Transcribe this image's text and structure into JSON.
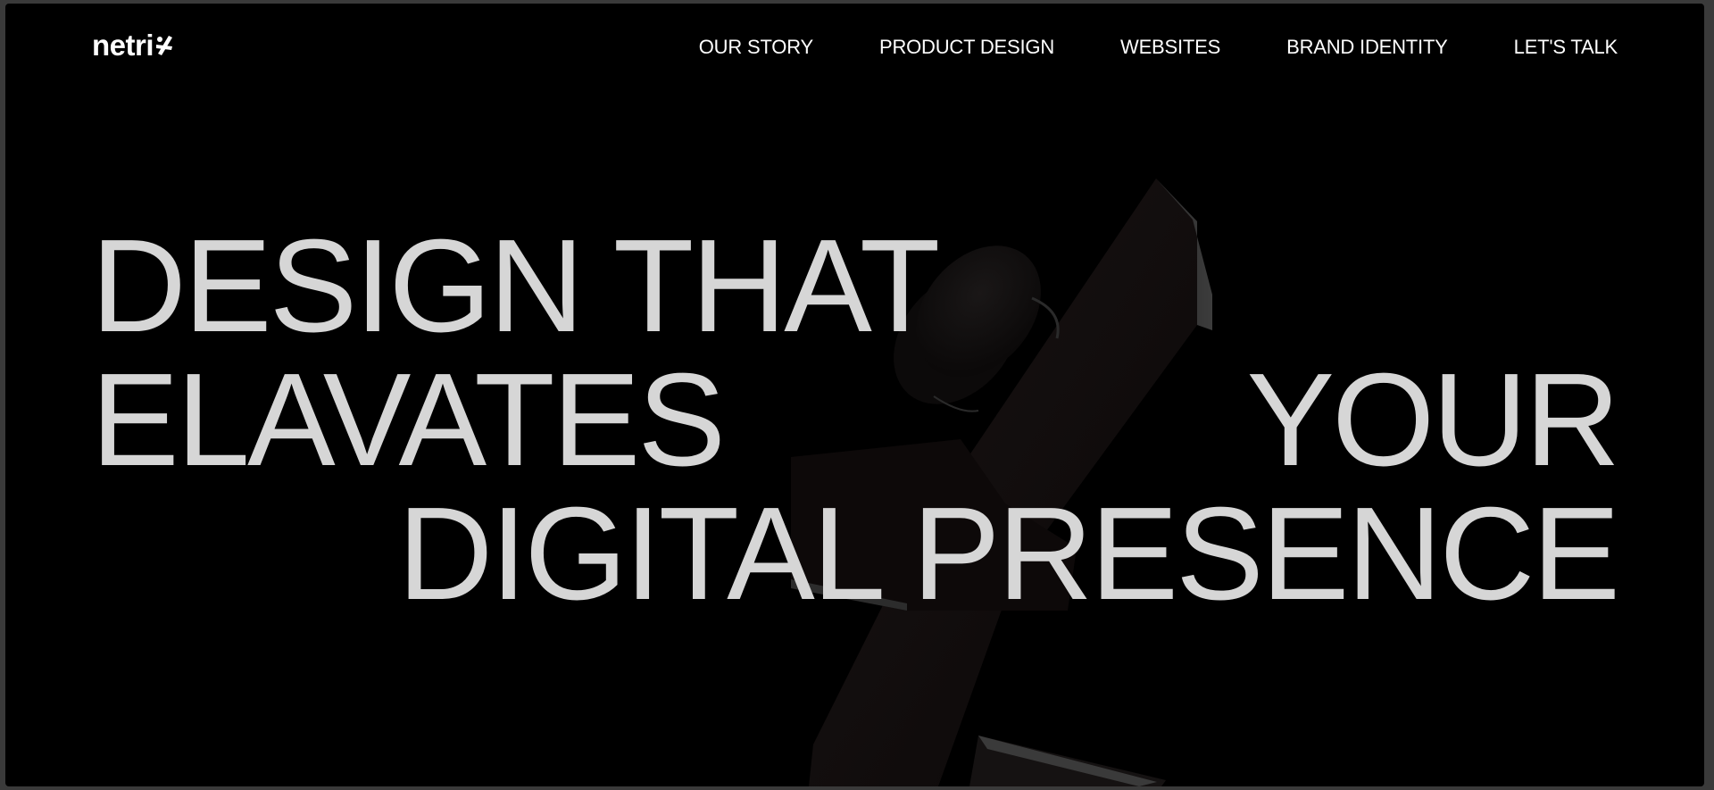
{
  "brand": {
    "logo_text": "netri",
    "logo_mark_icon": "x-figure-icon"
  },
  "nav": {
    "items": [
      {
        "label": "OUR STORY"
      },
      {
        "label": "PRODUCT DESIGN"
      },
      {
        "label": "WEBSITES"
      },
      {
        "label": "BRAND IDENTITY"
      },
      {
        "label": "LET'S TALK"
      }
    ]
  },
  "hero": {
    "line1": "DESIGN THAT",
    "line2_left": "ELAVATES",
    "line2_right": "YOUR",
    "line3": "DIGITAL PRESENCE",
    "background_icon": "x-figure-sculpture-icon"
  },
  "colors": {
    "background": "#000000",
    "headline": "#d6d6d6",
    "nav_text": "#ffffff"
  }
}
